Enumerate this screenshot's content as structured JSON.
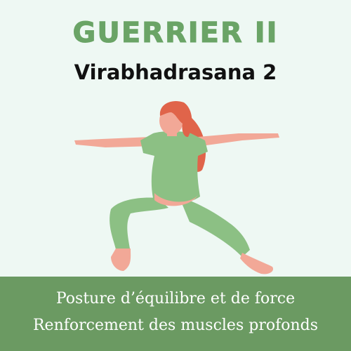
{
  "header": {
    "title": "GUERRIER II",
    "subtitle": "Virabhadrasana 2"
  },
  "illustration": {
    "icon": "yoga-warrior-pose-icon"
  },
  "banner": {
    "line1": "Posture d’équilibre et de force",
    "line2": "Renforcement des muscles profonds"
  },
  "colors": {
    "background": "#eef8f3",
    "title": "#6aa466",
    "subtitle": "#111111",
    "banner": "#6b9a62",
    "banner_text": "#ffffff",
    "clothing": "#8cc084",
    "skin": "#f2a897",
    "hair": "#e0644a"
  }
}
